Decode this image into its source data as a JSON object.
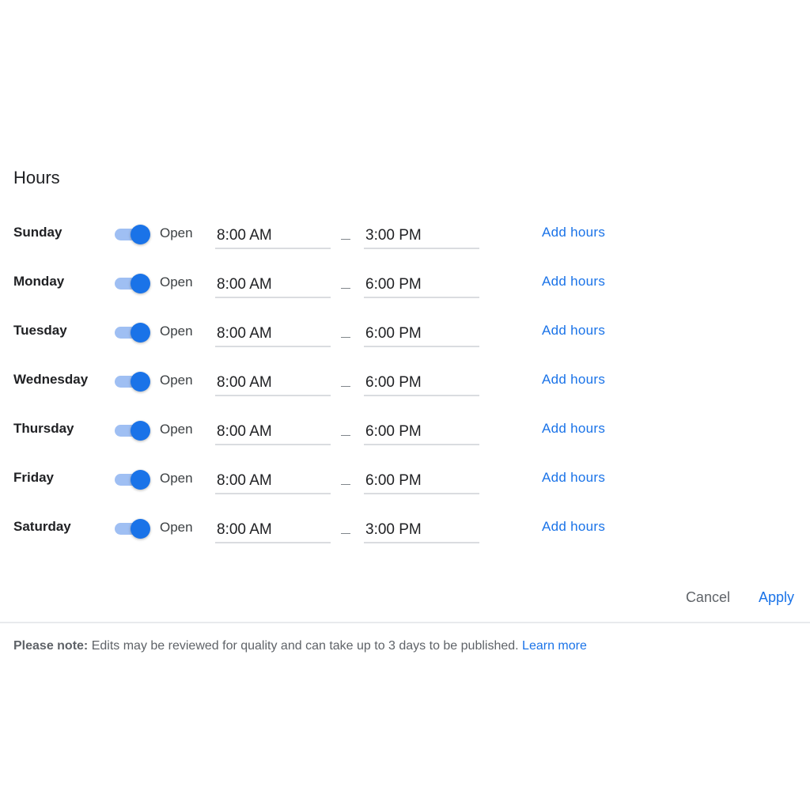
{
  "section": {
    "title": "Hours"
  },
  "days": [
    {
      "name": "Sunday",
      "status": "Open",
      "open": "8:00 AM",
      "close": "3:00 PM",
      "add_hours": "Add hours",
      "enabled": true
    },
    {
      "name": "Monday",
      "status": "Open",
      "open": "8:00 AM",
      "close": "6:00 PM",
      "add_hours": "Add hours",
      "enabled": true
    },
    {
      "name": "Tuesday",
      "status": "Open",
      "open": "8:00 AM",
      "close": "6:00 PM",
      "add_hours": "Add hours",
      "enabled": true
    },
    {
      "name": "Wednesday",
      "status": "Open",
      "open": "8:00 AM",
      "close": "6:00 PM",
      "add_hours": "Add hours",
      "enabled": true
    },
    {
      "name": "Thursday",
      "status": "Open",
      "open": "8:00 AM",
      "close": "6:00 PM",
      "add_hours": "Add hours",
      "enabled": true
    },
    {
      "name": "Friday",
      "status": "Open",
      "open": "8:00 AM",
      "close": "6:00 PM",
      "add_hours": "Add hours",
      "enabled": true
    },
    {
      "name": "Saturday",
      "status": "Open",
      "open": "8:00 AM",
      "close": "3:00 PM",
      "add_hours": "Add hours",
      "enabled": true
    }
  ],
  "actions": {
    "cancel_label": "Cancel",
    "apply_label": "Apply"
  },
  "note": {
    "prefix": "Please note:",
    "text": " Edits may be reviewed for quality and can take up to 3 days to be published. ",
    "link": "Learn more"
  },
  "colors": {
    "accent": "#1a73e8",
    "toggle_track": "#9fbff3",
    "divider": "#e8eaed"
  },
  "icons": {
    "separator": "dash"
  }
}
